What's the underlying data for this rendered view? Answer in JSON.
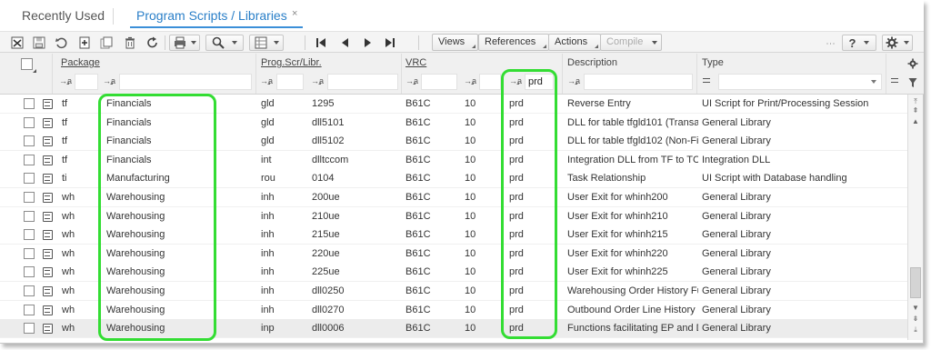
{
  "tabs": [
    {
      "label": "Recently Used"
    },
    {
      "label": "Program Scripts / Libraries",
      "close": "×"
    }
  ],
  "toolbar": {
    "views": "Views",
    "references": "References",
    "actions": "Actions",
    "compile": "Compile",
    "help": "?"
  },
  "columns": {
    "package": "Package",
    "prog": "Prog.Scr/Libr.",
    "vrc": "VRC",
    "description": "Description",
    "type": "Type"
  },
  "filters": {
    "op": "→a",
    "vrc_value": "prd"
  },
  "rows": [
    {
      "pkg": "tf",
      "pkgdesc": "Financials",
      "mod": "gld",
      "prog": "1295",
      "vrc": "B61C",
      "rel": "10",
      "cust": "prd",
      "desc": "Reverse Entry",
      "type": "UI Script for Print/Processing Session"
    },
    {
      "pkg": "tf",
      "pkgdesc": "Financials",
      "mod": "gld",
      "prog": "dll5101",
      "vrc": "B61C",
      "rel": "10",
      "cust": "prd",
      "desc": "DLL for table tfgld101 (Transac",
      "type": "General Library"
    },
    {
      "pkg": "tf",
      "pkgdesc": "Financials",
      "mod": "gld",
      "prog": "dll5102",
      "vrc": "B61C",
      "rel": "10",
      "cust": "prd",
      "desc": "DLL for table tfgld102 (Non-Fir",
      "type": "General Library"
    },
    {
      "pkg": "tf",
      "pkgdesc": "Financials",
      "mod": "int",
      "prog": "dlltccom",
      "vrc": "B61C",
      "rel": "10",
      "cust": "prd",
      "desc": "Integration DLL from TF to TCC",
      "type": "Integration DLL"
    },
    {
      "pkg": "ti",
      "pkgdesc": "Manufacturing",
      "mod": "rou",
      "prog": "0104",
      "vrc": "B61C",
      "rel": "10",
      "cust": "prd",
      "desc": "Task Relationship",
      "type": "UI Script with Database handling"
    },
    {
      "pkg": "wh",
      "pkgdesc": "Warehousing",
      "mod": "inh",
      "prog": "200ue",
      "vrc": "B61C",
      "rel": "10",
      "cust": "prd",
      "desc": "User Exit for whinh200",
      "type": "General Library"
    },
    {
      "pkg": "wh",
      "pkgdesc": "Warehousing",
      "mod": "inh",
      "prog": "210ue",
      "vrc": "B61C",
      "rel": "10",
      "cust": "prd",
      "desc": "User Exit for whinh210",
      "type": "General Library"
    },
    {
      "pkg": "wh",
      "pkgdesc": "Warehousing",
      "mod": "inh",
      "prog": "215ue",
      "vrc": "B61C",
      "rel": "10",
      "cust": "prd",
      "desc": "User Exit for whinh215",
      "type": "General Library"
    },
    {
      "pkg": "wh",
      "pkgdesc": "Warehousing",
      "mod": "inh",
      "prog": "220ue",
      "vrc": "B61C",
      "rel": "10",
      "cust": "prd",
      "desc": "User Exit for whinh220",
      "type": "General Library"
    },
    {
      "pkg": "wh",
      "pkgdesc": "Warehousing",
      "mod": "inh",
      "prog": "225ue",
      "vrc": "B61C",
      "rel": "10",
      "cust": "prd",
      "desc": "User Exit for whinh225",
      "type": "General Library"
    },
    {
      "pkg": "wh",
      "pkgdesc": "Warehousing",
      "mod": "inh",
      "prog": "dll0250",
      "vrc": "B61C",
      "rel": "10",
      "cust": "prd",
      "desc": "Warehousing Order History Fu",
      "type": "General Library"
    },
    {
      "pkg": "wh",
      "pkgdesc": "Warehousing",
      "mod": "inh",
      "prog": "dll0270",
      "vrc": "B61C",
      "rel": "10",
      "cust": "prd",
      "desc": "Outbound Order Line History F",
      "type": "General Library"
    },
    {
      "pkg": "wh",
      "pkgdesc": "Warehousing",
      "mod": "inp",
      "prog": "dll0006",
      "vrc": "B61C",
      "rel": "10",
      "cust": "prd",
      "desc": "Functions facilitating EP and D",
      "type": "General Library"
    }
  ],
  "colors": {
    "tab_active": "#2a7fc8",
    "highlight": "#33dd33",
    "header_bg": "#f0f0f0"
  }
}
